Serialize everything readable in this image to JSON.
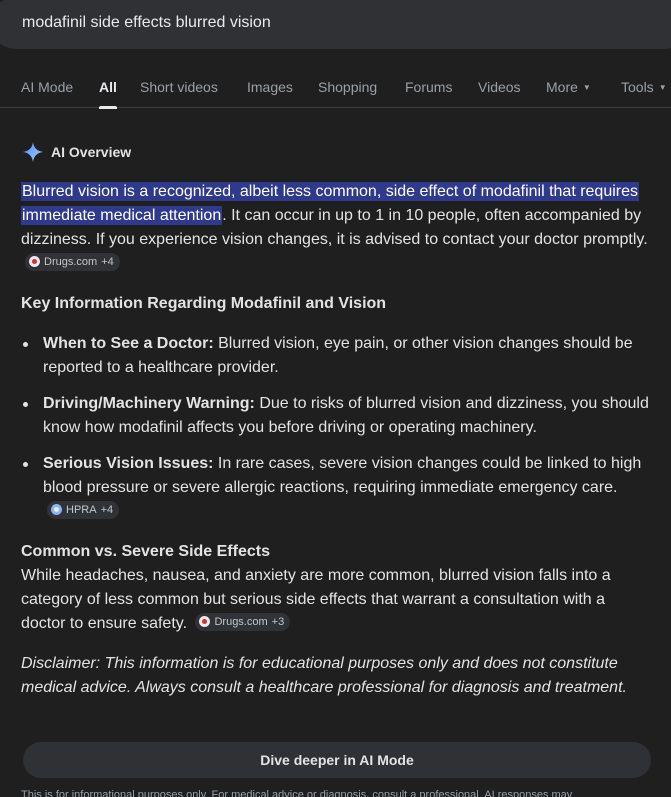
{
  "search": {
    "query": "modafinil side effects blurred vision"
  },
  "tabs": [
    {
      "label": "AI Mode"
    },
    {
      "label": "All"
    },
    {
      "label": "Short videos"
    },
    {
      "label": "Images"
    },
    {
      "label": "Shopping"
    },
    {
      "label": "Forums"
    },
    {
      "label": "Videos"
    },
    {
      "label": "More"
    },
    {
      "label": "Tools"
    }
  ],
  "active_tab": "All",
  "overview": {
    "title": "AI Overview",
    "intro_highlight": "Blurred vision is a recognized, albeit less common, side effect of modafinil that requires immediate medical attention",
    "intro_rest": ". It can occur in up to 1 in 10 people, often accompanied by dizziness. If you experience vision changes, it is advised to contact your doctor promptly.",
    "intro_source": {
      "name": "Drugs.com",
      "more": "+4"
    },
    "key_heading": "Key Information Regarding Modafinil and Vision",
    "bullets": [
      {
        "label": "When to See a Doctor:",
        "text": " Blurred vision, eye pain, or other vision changes should be reported to a healthcare provider."
      },
      {
        "label": "Driving/Machinery Warning:",
        "text": " Due to risks of blurred vision and dizziness, you should know how modafinil affects you before driving or operating machinery."
      },
      {
        "label": "Serious Vision Issues:",
        "text": " In rare cases, severe vision changes could be linked to high blood pressure or severe allergic reactions, requiring immediate emergency care.",
        "source": {
          "name": "HPRA",
          "more": "+4"
        }
      }
    ],
    "common_heading": "Common vs. Severe Side Effects",
    "common_text": "While headaches, nausea, and anxiety are more common, blurred vision falls into a category of less common but serious side effects that warrant a consultation with a doctor to ensure safety.",
    "common_source": {
      "name": "Drugs.com",
      "more": "+3"
    },
    "disclaimer": "Disclaimer: This information is for educational purposes only and does not constitute medical advice. Always consult a healthcare professional for diagnosis and treatment."
  },
  "dive_button": "Dive deeper in AI Mode",
  "footer": "This is for informational purposes only. For medical advice or diagnosis, consult a professional. AI responses may",
  "colors": {
    "background": "#1f1f1f",
    "highlight": "#2f3a8c",
    "accent": "#8ab4f8"
  },
  "icons": {
    "ai_overview": "sparkle-icon",
    "more_caret": "caret-down-icon"
  }
}
